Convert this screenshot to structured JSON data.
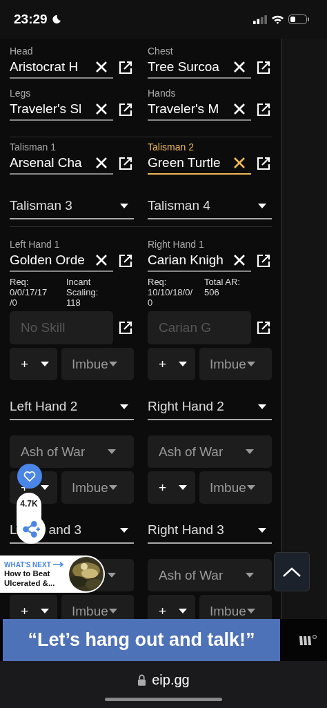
{
  "status_bar": {
    "time": "23:29"
  },
  "groups": [
    {
      "rows": [
        {
          "kind": "item",
          "cells": [
            {
              "label": "Head",
              "value": "Aristocrat H",
              "focused": false
            },
            {
              "label": "Chest",
              "value": "Tree Surcoa",
              "focused": false
            }
          ]
        },
        {
          "kind": "item",
          "cells": [
            {
              "label": "Legs",
              "value": "Traveler's Sl",
              "focused": false
            },
            {
              "label": "Hands",
              "value": "Traveler's M",
              "focused": false
            }
          ]
        }
      ]
    },
    {
      "rows": [
        {
          "kind": "item",
          "cells": [
            {
              "label": "Talisman 1",
              "value": "Arsenal Cha",
              "focused": false
            },
            {
              "label": "Talisman 2",
              "value": "Green Turtle",
              "focused": true
            }
          ]
        },
        {
          "kind": "select",
          "cells": [
            {
              "placeholder": "Talisman 3"
            },
            {
              "placeholder": "Talisman 4"
            }
          ]
        }
      ]
    },
    {
      "rows": [
        {
          "kind": "item",
          "cells": [
            {
              "label": "Left Hand 1",
              "value": "Golden Orde",
              "focused": false
            },
            {
              "label": "Right Hand 1",
              "value": "Carian Knigh",
              "focused": false
            }
          ]
        },
        {
          "kind": "stats",
          "cells": [
            {
              "columns": [
                [
                  "Req:",
                  "0/0/17/17",
                  "/0"
                ],
                [
                  "Incant",
                  "Scaling:",
                  "118"
                ]
              ]
            },
            {
              "columns": [
                [
                  "Req:",
                  "10/10/18/0/",
                  "0"
                ],
                [
                  "Total AR:",
                  "506"
                ]
              ]
            }
          ]
        },
        {
          "kind": "skill",
          "cells": [
            {
              "value": "No Skill",
              "disabled": true
            },
            {
              "value": "Carian G",
              "disabled": true
            }
          ]
        },
        {
          "kind": "upgrade",
          "cells": [
            {
              "affinity": "+",
              "imbue": "Imbue"
            },
            {
              "affinity": "+",
              "imbue": "Imbue"
            }
          ]
        },
        {
          "kind": "select",
          "cells": [
            {
              "placeholder": "Left Hand 2"
            },
            {
              "placeholder": "Right Hand 2"
            }
          ]
        },
        {
          "kind": "ash",
          "cells": [
            {
              "value": "Ash of War"
            },
            {
              "value": "Ash of War"
            }
          ]
        },
        {
          "kind": "upgrade",
          "cells": [
            {
              "affinity": "+",
              "imbue": "Imbue"
            },
            {
              "affinity": "+",
              "imbue": "Imbue"
            }
          ]
        },
        {
          "kind": "select",
          "cells": [
            {
              "placeholder_parts": [
                "L",
                "and 3"
              ]
            },
            {
              "placeholder": "Right Hand 3"
            }
          ]
        },
        {
          "kind": "ash",
          "cells": [
            {},
            {
              "value": "Ash of War"
            }
          ]
        },
        {
          "kind": "upgrade",
          "cells": [
            {
              "affinity": "+",
              "imbue": "Imbue"
            },
            {
              "affinity": "+",
              "imbue": "Imbue"
            }
          ]
        }
      ]
    }
  ],
  "like": {
    "count": "4.7K"
  },
  "whats_next": {
    "heading": "WHAT'S NEXT",
    "title": "How to Beat",
    "subtitle": "Ulcerated &..."
  },
  "ad": {
    "text": "“Let’s hang out and talk!”"
  },
  "browser": {
    "url": "eip.gg"
  }
}
